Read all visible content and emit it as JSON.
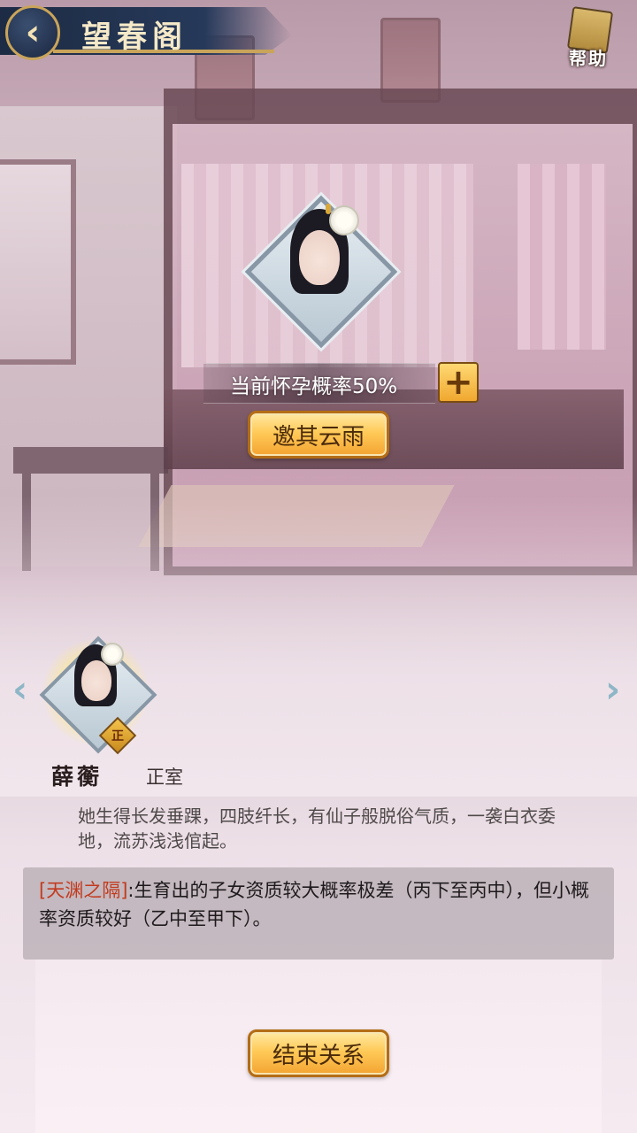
{
  "header": {
    "title": "望春阁",
    "back_label": "‹",
    "help_label": "帮助"
  },
  "pregnancy": {
    "probability_text": "当前怀孕概率50%",
    "plus_label": "+",
    "invite_label": "邀其云雨"
  },
  "consort": {
    "name": "薛蘅",
    "rank": "正室",
    "rank_badge": "正",
    "description": "她生得长发垂踝，四肢纤长，有仙子般脱俗气质，一袭白衣委地，流苏浅浅倌起。",
    "trait_name": "[天渊之隔]",
    "trait_desc": ":生育出的子女资质较大概率极差（丙下至丙中），但小概率资质较好（乙中至甲下）。"
  },
  "nav": {
    "prev": "‹",
    "next": "›"
  },
  "actions": {
    "end_label": "结束关系"
  },
  "colors": {
    "title_banner": "#1d2c44",
    "gold_button": "#ffca58",
    "trait_highlight": "#c23a1e",
    "nav_arrow": "#8eb6c6"
  }
}
